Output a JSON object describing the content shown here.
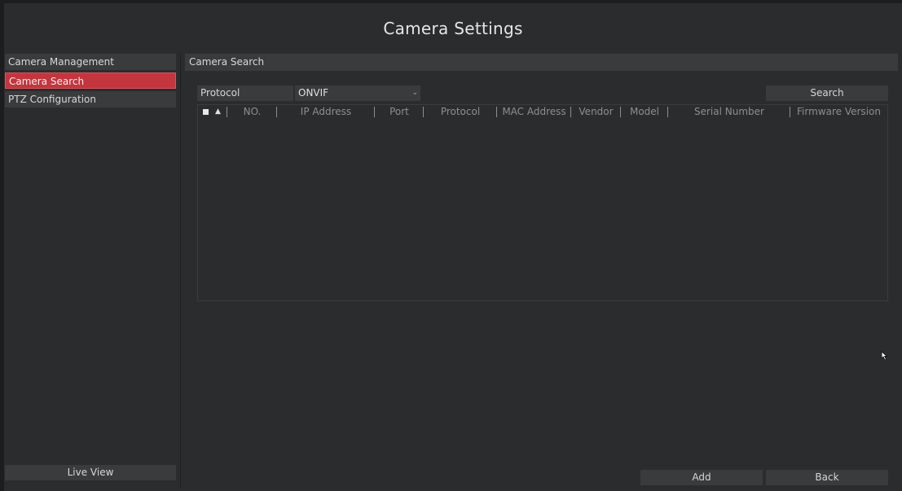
{
  "window": {
    "title": "Camera Settings"
  },
  "sidebar": {
    "items": [
      {
        "label": "Camera Management",
        "active": false
      },
      {
        "label": "Camera Search",
        "active": true
      },
      {
        "label": "PTZ Configuration",
        "active": false
      }
    ],
    "live_view_label": "Live View"
  },
  "main": {
    "section_title": "Camera Search",
    "protocol_label": "Protocol",
    "protocol_value": "ONVIF",
    "search_label": "Search",
    "table": {
      "columns": [
        "NO.",
        "IP Address",
        "Port",
        "Protocol",
        "MAC Address",
        "Vendor",
        "Model",
        "Serial Number",
        "Firmware Version"
      ],
      "rows": []
    },
    "add_label": "Add",
    "back_label": "Back"
  },
  "colors": {
    "accent": "#c4353d",
    "background": "#2b2c2e",
    "panel": "#3a3b3d"
  },
  "icons": {
    "protocol_dropdown": "chevron-down-icon",
    "sort": "caret-up-icon",
    "cursor": "mouse-pointer-icon"
  }
}
